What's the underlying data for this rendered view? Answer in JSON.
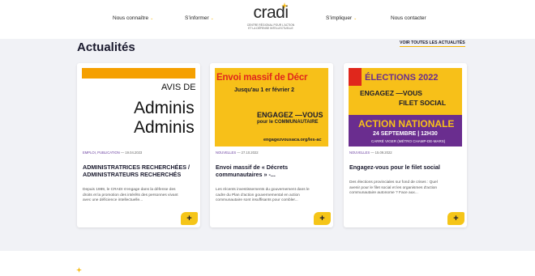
{
  "nav": {
    "left": [
      {
        "label": "Nous connaître",
        "has_menu": true
      },
      {
        "label": "S’informer",
        "has_menu": true
      }
    ],
    "right": [
      {
        "label": "S’impliquer",
        "has_menu": true
      },
      {
        "label": "Nous contacter",
        "has_menu": false
      }
    ],
    "caret": "⌄"
  },
  "logo": {
    "wordmark": "cradi",
    "tagline_1": "CENTRE RÉGIONAL POUR L’ACTION",
    "tagline_2": "ET LA DÉFENSE INTELLECTUELLE"
  },
  "news": {
    "title": "Actualités",
    "see_all": "VOIR TOUTES LES ACTUALITÉS",
    "cards": [
      {
        "image": {
          "line1": "AVIS DE",
          "line2": "Adminis",
          "line3": "Adminis"
        },
        "category": "EMPLOI, PUBLICATION",
        "date": "— 19.04.2023",
        "title": "ADMINISTRATRICES RECHERCHÉES / ADMINISTRATEURS RECHERCHÉS",
        "excerpt": "Depuis 1989, le CRADI s'engage dans la défense des droits et la promotion des intérêts des personnes vivant avec une déficience intellectuelle...",
        "more": "+"
      },
      {
        "image": {
          "line1": "Envoi massif de Décr",
          "line2": "Jusqu'au 1 er février 2",
          "line3": "ENGAGEZ —VOUS",
          "line3b": "pour le COMMUNAUTAIRE",
          "line4": "engagezvousaca.org/les-ac"
        },
        "category": "NOUVELLES",
        "date": "— 27.10.2022",
        "title": "Envoi massif de « Décrets communautaires » -...",
        "excerpt": "Les récents investissements du gouvernement dans le cadre du Plan d'action gouvernemental en action communautaire sont insuffisants pour combler...",
        "more": "+"
      },
      {
        "image": {
          "line1": "ÉLECTIONS 2022",
          "line2": "ENGAGEZ —VOUS",
          "line3": "FILET SOCIAL",
          "line4": "ACTION NATIONALE",
          "line5": "24 SEPTEMBRE | 12H30",
          "line6": "CARRÉ VIGER (MÉTRO CHAMP-DE-MARS)"
        },
        "category": "NOUVELLES",
        "date": "— 15.09.2022",
        "title": "Engagez-vous pour le filet social",
        "excerpt": "Des élections provinciales sur fond de crises : Quel avenir pour le filet social et les organismes d'action communautaire autonome ? Face aux...",
        "more": "+"
      }
    ]
  },
  "colors": {
    "accent": "#f5c518",
    "purple": "#6a2d8f",
    "red": "#e0271c",
    "band": "#f1f2f6"
  },
  "icons": [
    "chevron-down-icon",
    "plus-icon",
    "spark-icon"
  ]
}
